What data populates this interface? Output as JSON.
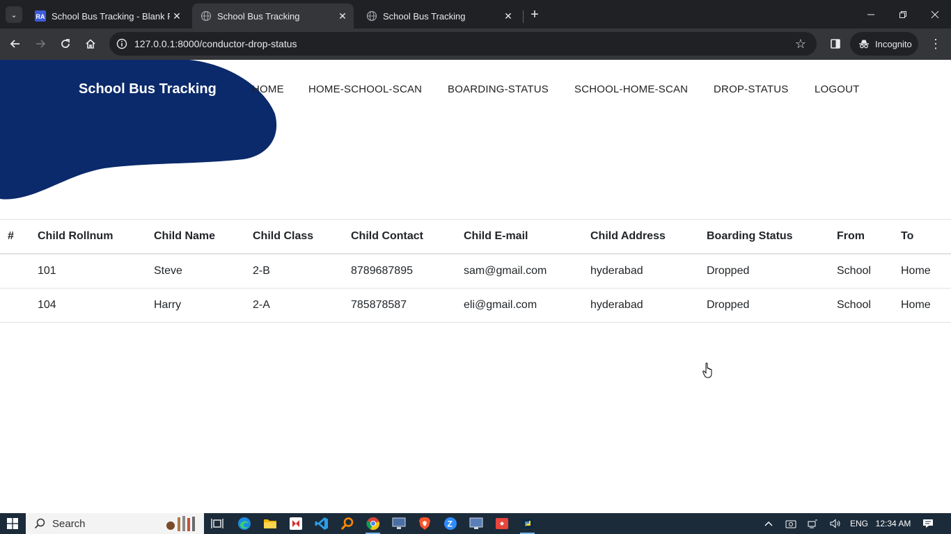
{
  "browser": {
    "tabs": [
      {
        "title": "School Bus Tracking - Blank Pa",
        "favicon": "ra-icon",
        "active": false
      },
      {
        "title": "School Bus Tracking",
        "favicon": "globe-icon",
        "active": true
      },
      {
        "title": "School Bus Tracking",
        "favicon": "globe-icon",
        "active": false
      }
    ],
    "url": "127.0.0.1:8000/conductor-drop-status",
    "profile_label": "Incognito"
  },
  "page": {
    "brand": "School Bus Tracking",
    "nav": [
      "HOME",
      "HOME-SCHOOL-SCAN",
      "BOARDING-STATUS",
      "SCHOOL-HOME-SCAN",
      "DROP-STATUS",
      "LOGOUT"
    ],
    "table": {
      "headers": [
        "#",
        "Child Rollnum",
        "Child Name",
        "Child Class",
        "Child Contact",
        "Child E-mail",
        "Child Address",
        "Boarding Status",
        "From",
        "To"
      ],
      "rows": [
        [
          "",
          "101",
          "Steve",
          "2-B",
          "8789687895",
          "sam@gmail.com",
          "hyderabad",
          "Dropped",
          "School",
          "Home"
        ],
        [
          "",
          "104",
          "Harry",
          "2-A",
          "785878587",
          "eli@gmail.com",
          "hyderabad",
          "Dropped",
          "School",
          "Home"
        ]
      ]
    }
  },
  "colors": {
    "brand_blob": "#0b2a6b",
    "taskbar": "#1c2b3a",
    "tabstrip": "#202124",
    "toolbar": "#35363a"
  },
  "taskbar": {
    "search_label": "Search",
    "language": "ENG",
    "time": "12:34 AM"
  }
}
